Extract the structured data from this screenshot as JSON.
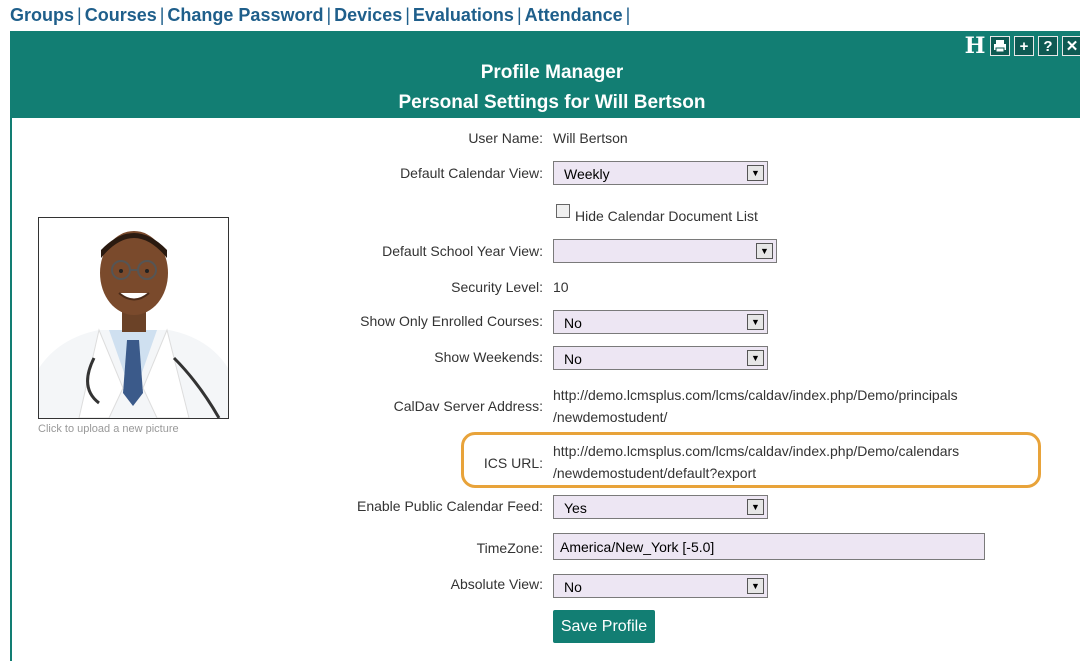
{
  "nav": {
    "items": [
      "Groups",
      "Courses",
      "Change Password",
      "Devices",
      "Evaluations",
      "Attendance"
    ],
    "separator": "|"
  },
  "header": {
    "title": "Profile Manager",
    "subtitle": "Personal Settings for Will Bertson",
    "icons": [
      "H",
      "print-icon",
      "+",
      "?",
      "✕"
    ]
  },
  "photo": {
    "caption": "Click to upload a new picture"
  },
  "form": {
    "user_name_label": "User Name:",
    "user_name_value": "Will Bertson",
    "calendar_view_label": "Default Calendar View:",
    "calendar_view_value": "Weekly",
    "hide_doc_list_label": "Hide Calendar Document List",
    "school_year_label": "Default School Year View:",
    "school_year_value": "",
    "security_label": "Security Level:",
    "security_value": "10",
    "enrolled_label": "Show Only Enrolled Courses:",
    "enrolled_value": "No",
    "weekends_label": "Show Weekends:",
    "weekends_value": "No",
    "caldav_label": "CalDav Server Address:",
    "caldav_line1": "http://demo.lcmsplus.com/lcms/caldav/index.php/Demo/principals",
    "caldav_line2": "/newdemostudent/",
    "ics_label": "ICS URL:",
    "ics_line1": "http://demo.lcmsplus.com/lcms/caldav/index.php/Demo/calendars",
    "ics_line2": "/newdemostudent/default?export",
    "public_feed_label": "Enable Public Calendar Feed:",
    "public_feed_value": "Yes",
    "timezone_label": "TimeZone:",
    "timezone_value": "America/New_York [-5.0]",
    "absolute_label": "Absolute View:",
    "absolute_value": "No",
    "save_label": "Save Profile"
  },
  "colors": {
    "accent": "#127e73",
    "nav": "#1f5f8b",
    "highlight": "#e8a33a",
    "field": "#ede6f3"
  }
}
